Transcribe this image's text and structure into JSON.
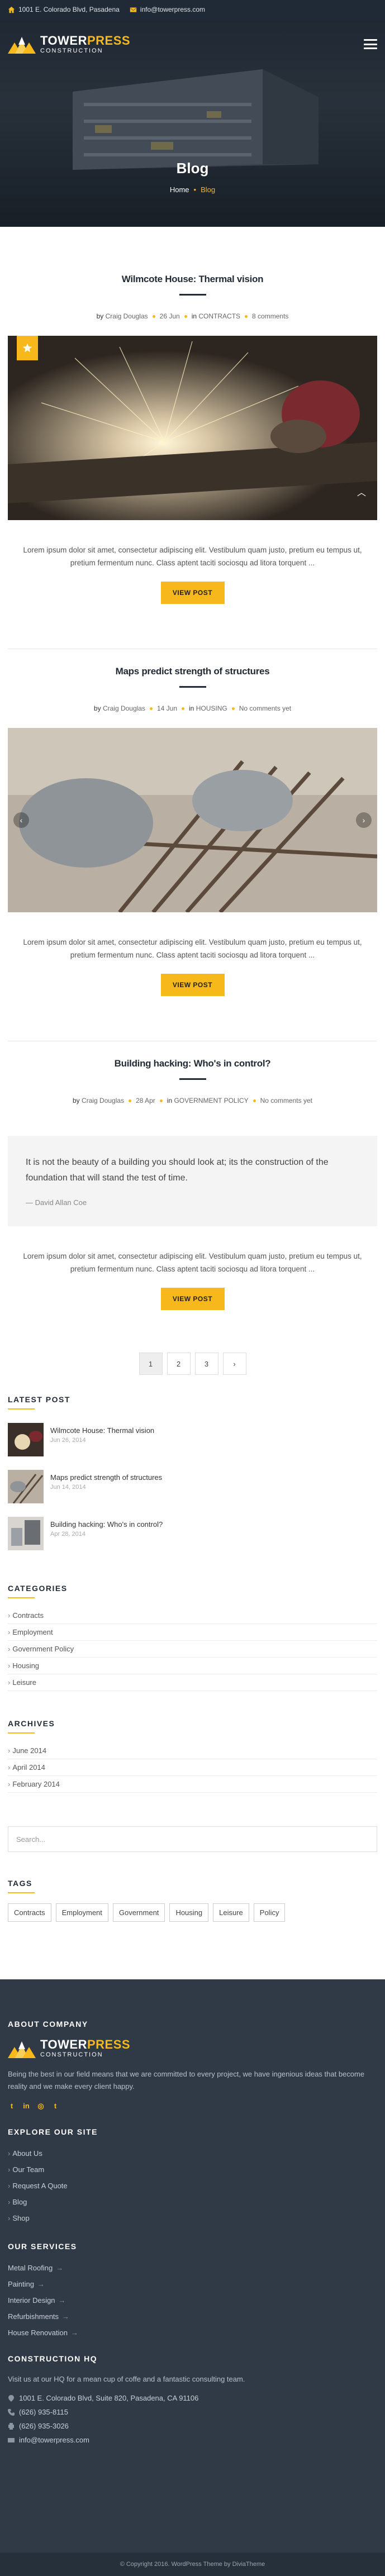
{
  "topbar": {
    "address": "1001 E. Colorado Blvd, Pasadena",
    "email": "info@towerpress.com"
  },
  "brand": {
    "name_part1": "TOWER",
    "name_part2": "PRESS",
    "tagline": "CONSTRUCTION",
    "accent": "#f7b81b",
    "dark": "#222b35"
  },
  "hero": {
    "title": "Blog",
    "breadcrumb": [
      "Home",
      "Blog"
    ]
  },
  "posts": [
    {
      "title": "Wilmcote House: Thermal vision",
      "author": "Craig Douglas",
      "date": "26 Jun",
      "category": "CONTRACTS",
      "comments": "8 comments",
      "excerpt": "Lorem ipsum dolor sit amet, consectetur adipiscing elit. Vestibulum quam justo, pretium eu tempus ut, pretium fermentum nunc. Class aptent taciti sociosqu ad litora torquent ...",
      "button": "VIEW POST",
      "media": "photo",
      "format_icon": "star-icon"
    },
    {
      "title": "Maps predict strength of structures",
      "author": "Craig Douglas",
      "date": "14 Jun",
      "category": "HOUSING",
      "comments": "No comments yet",
      "excerpt": "Lorem ipsum dolor sit amet, consectetur adipiscing elit. Vestibulum quam justo, pretium eu tempus ut, pretium fermentum nunc. Class aptent taciti sociosqu ad litora torquent ...",
      "button": "VIEW POST",
      "media": "gallery"
    },
    {
      "title": "Building hacking: Who's in control?",
      "author": "Craig Douglas",
      "date": "28 Apr",
      "category": "GOVERNMENT POLICY",
      "comments": "No comments yet",
      "quote": "It is not the beauty of a building you should look at; its the construction of the foundation that will stand the test of time.",
      "quote_author": "— David Allan Coe",
      "excerpt": "Lorem ipsum dolor sit amet, consectetur adipiscing elit. Vestibulum quam justo, pretium eu tempus ut, pretium fermentum nunc. Class aptent taciti sociosqu ad litora torquent ...",
      "button": "VIEW POST",
      "media": "quote"
    }
  ],
  "meta_labels": {
    "by": "by",
    "in": "in"
  },
  "pagination": {
    "pages": [
      "1",
      "2",
      "3"
    ],
    "next": "›",
    "current": "1"
  },
  "sidebar": {
    "latest_title": "LATEST POST",
    "latest": [
      {
        "title": "Wilmcote House: Thermal vision",
        "date": "Jun 26, 2014"
      },
      {
        "title": "Maps predict strength of structures",
        "date": "Jun 14, 2014"
      },
      {
        "title": "Building hacking: Who's in control?",
        "date": "Apr 28, 2014"
      }
    ],
    "categories_title": "CATEGORIES",
    "categories": [
      "Contracts",
      "Employment",
      "Government Policy",
      "Housing",
      "Leisure"
    ],
    "archives_title": "ARCHIVES",
    "archives": [
      "June 2014",
      "April 2014",
      "February 2014"
    ],
    "search_placeholder": "Search...",
    "tags_title": "TAGS",
    "tags": [
      "Contracts",
      "Employment",
      "Government",
      "Housing",
      "Leisure",
      "Policy"
    ]
  },
  "footer": {
    "about_title": "ABOUT COMPANY",
    "about_text": "Being the best in our field means that we are committed to every project, we have ingenious ideas that become reality and we make every client happy.",
    "socials": [
      "twitter-icon",
      "linkedin-icon",
      "instagram-icon",
      "tumblr-icon"
    ],
    "explore_title": "EXPLORE OUR SITE",
    "explore": [
      "About Us",
      "Our Team",
      "Request A Quote",
      "Blog",
      "Shop"
    ],
    "services_title": "OUR SERVICES",
    "services": [
      "Metal Roofing",
      "Painting",
      "Interior Design",
      "Refurbishments",
      "House Renovation"
    ],
    "hq_title": "CONSTRUCTION HQ",
    "hq_text": "Visit us at our HQ for a mean cup of coffe and a fantastic consulting team.",
    "contacts": [
      {
        "icon": "location-pin-icon",
        "text": "1001 E. Colorado Blvd, Suite 820, Pasadena, CA 91106"
      },
      {
        "icon": "phone-icon",
        "text": "(626) 935-8115"
      },
      {
        "icon": "printer-icon",
        "text": "(626) 935-3026"
      },
      {
        "icon": "envelope-icon",
        "text": "info@towerpress.com"
      }
    ],
    "copyright": "© Copyright 2016. WordPress Theme by DiviaTheme"
  }
}
